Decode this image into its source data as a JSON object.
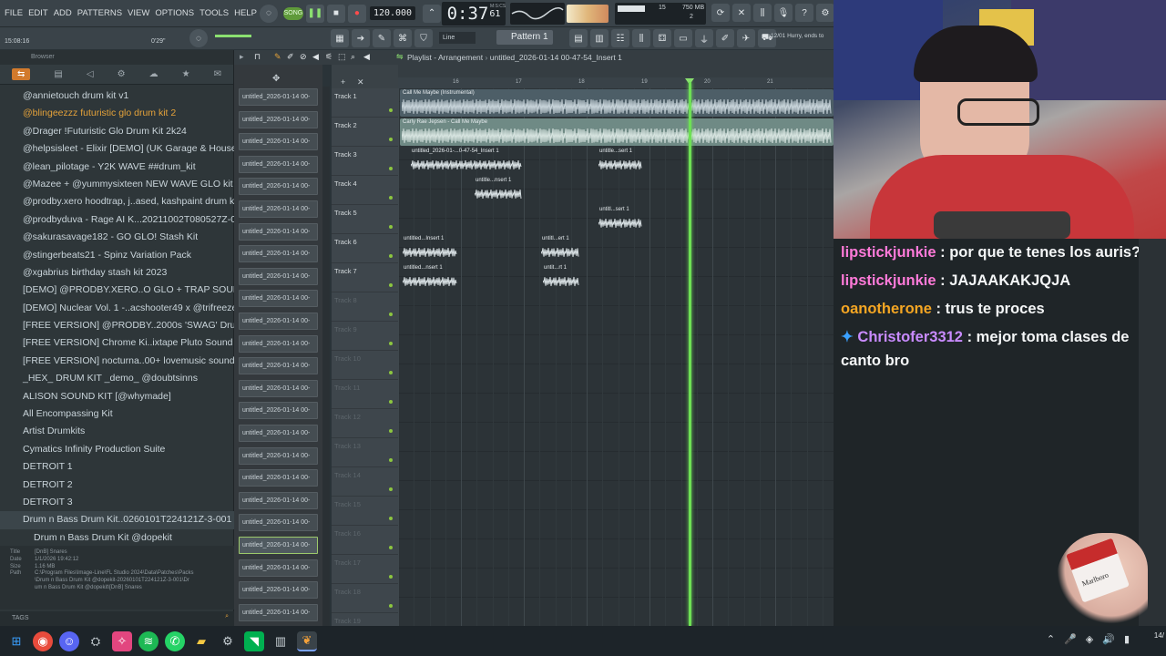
{
  "menu": [
    "FILE",
    "EDIT",
    "ADD",
    "PATTERNS",
    "VIEW",
    "OPTIONS",
    "TOOLS",
    "HELP"
  ],
  "transport": {
    "song_label": "SONG",
    "tempo": "120.000",
    "time_main": "0:37",
    "time_sub": "61",
    "time_unit": "M:S:CS",
    "cpu_value": "15",
    "mem_value": "750 MB",
    "poly_value": "2"
  },
  "status": {
    "clock": "15:08:16",
    "position": "0'29\"",
    "snap": "Line",
    "pattern": "Pattern 1",
    "hint": "12/01  Hurry, ends to"
  },
  "browser": {
    "title": "Browser",
    "items": [
      {
        "label": "@annietouch drum kit v1",
        "style": "normal"
      },
      {
        "label": "@blingeezzz futuristic glo drum kit 2",
        "style": "hl"
      },
      {
        "label": "@Drager !Futuristic Glo Drum Kit 2k24",
        "style": "normal"
      },
      {
        "label": "@helpsisleet - Elixir [DEMO] (UK Garage & House)",
        "style": "normal"
      },
      {
        "label": "@lean_pilotage - Y2K WAVE ##drum_kit",
        "style": "normal"
      },
      {
        "label": "@Mazee + @yummysixteen NEW WAVE GLO kit",
        "style": "normal"
      },
      {
        "label": "@prodby.xero hoodtrap, j..ased, kashpaint drum kit",
        "style": "normal"
      },
      {
        "label": "@prodbyduva - Rage AI K...20211002T080527Z-001",
        "style": "normal"
      },
      {
        "label": "@sakurasavage182 - GO GLO! Stash Kit",
        "style": "normal"
      },
      {
        "label": "@stingerbeats21 - Spinz Variation Pack",
        "style": "normal"
      },
      {
        "label": "@xgabrius birthday stash kit 2023",
        "style": "normal"
      },
      {
        "label": "[DEMO] @PRODBY.XERO..O GLO + TRAP SOUND KIT",
        "style": "normal"
      },
      {
        "label": "[DEMO] Nuclear Vol. 1 -..acshooter49 x @trifreeze",
        "style": "normal"
      },
      {
        "label": "[FREE VERSION] @PRODBY..2000s 'SWAG' Drum Kit",
        "style": "normal"
      },
      {
        "label": "[FREE VERSION] Chrome Ki..ixtape Pluto Sound Kit",
        "style": "normal"
      },
      {
        "label": "[FREE VERSION] nocturna..00+ lovemusic sound kit",
        "style": "normal"
      },
      {
        "label": "_HEX_ DRUM KIT _demo_ @doubtsinns",
        "style": "normal"
      },
      {
        "label": "ALISON SOUND KIT [@whymade]",
        "style": "normal"
      },
      {
        "label": "All Encompassing Kit",
        "style": "normal"
      },
      {
        "label": "Artist Drumkits",
        "style": "normal"
      },
      {
        "label": "Cymatics Infinity Production Suite",
        "style": "normal"
      },
      {
        "label": "DETROIT 1",
        "style": "normal"
      },
      {
        "label": "DETROIT 2",
        "style": "normal"
      },
      {
        "label": "DETROIT 3",
        "style": "normal"
      },
      {
        "label": "Drum n Bass Drum Kit..0260101T224121Z-3-001",
        "style": "sel"
      },
      {
        "label": "Drum n Bass Drum Kit @dopekit",
        "style": "sub"
      }
    ],
    "info": {
      "title_k": "Title",
      "title_v": "[DnB] Snares",
      "date_k": "Date",
      "date_v": "1/1/2026 19:42:12",
      "size_k": "Size",
      "size_v": "1.16 MB",
      "path_k": "Path",
      "path_v1": "C:\\Program Files\\Image-Line\\FL Studio 2024\\Data\\Patches\\Packs",
      "path_v2": "\\Drum n Bass Drum Kit @dopekit-20260101T224121Z-3-001\\Dr",
      "path_v3": "um n Bass Drum Kit @dopekit\\[DnB] Snares"
    },
    "tags_label": "TAGS"
  },
  "picker": {
    "item_label": "untitled_2026-01-14 00-",
    "count": 24,
    "selected_index": 20
  },
  "playlist": {
    "title": "Playlist - Arrangement",
    "crumb": "untitled_2026-01-14 00-47-54_Insert 1",
    "ruler": [
      "16",
      "17",
      "18",
      "19",
      "20",
      "21"
    ],
    "tracks": [
      "Track 1",
      "Track 2",
      "Track 3",
      "Track 4",
      "Track 5",
      "Track 6",
      "Track 7",
      "Track 8",
      "Track 9",
      "Track 10",
      "Track 11",
      "Track 12",
      "Track 13",
      "Track 14",
      "Track 15",
      "Track 16",
      "Track 17",
      "Track 18",
      "Track 19"
    ],
    "clips": {
      "t1": "Call Me Maybe (Instrumental)",
      "t2": "Carly Rae Jepsen - Call Me Maybe",
      "t3a": "untitled_2026-01-...0-47-54_Insert 1",
      "t3b": "untitle...sert 1",
      "t4": "untitle...nsert 1",
      "t5": "untitl...sert 1",
      "t6a": "untitled...Insert 1",
      "t6b": "untitl...ert 1",
      "t7a": "untitled...nsert 1",
      "t7b": "untit...rt 1"
    }
  },
  "chat": [
    {
      "user": "lipstickjunkie",
      "color": "#ff7ad9",
      "text": "por que te tenes los auris?"
    },
    {
      "user": "lipstickjunkie",
      "color": "#ff7ad9",
      "text": "JAJAAKAKJQJA"
    },
    {
      "user": "oanotherone",
      "color": "#f5a623",
      "text": "trus te proces"
    },
    {
      "user": "Christofer3312",
      "color": "#c98bff",
      "text": "mejor toma clases de canto bro"
    }
  ],
  "product_text": "Marlboro",
  "taskbar": {
    "clock": "14/"
  }
}
